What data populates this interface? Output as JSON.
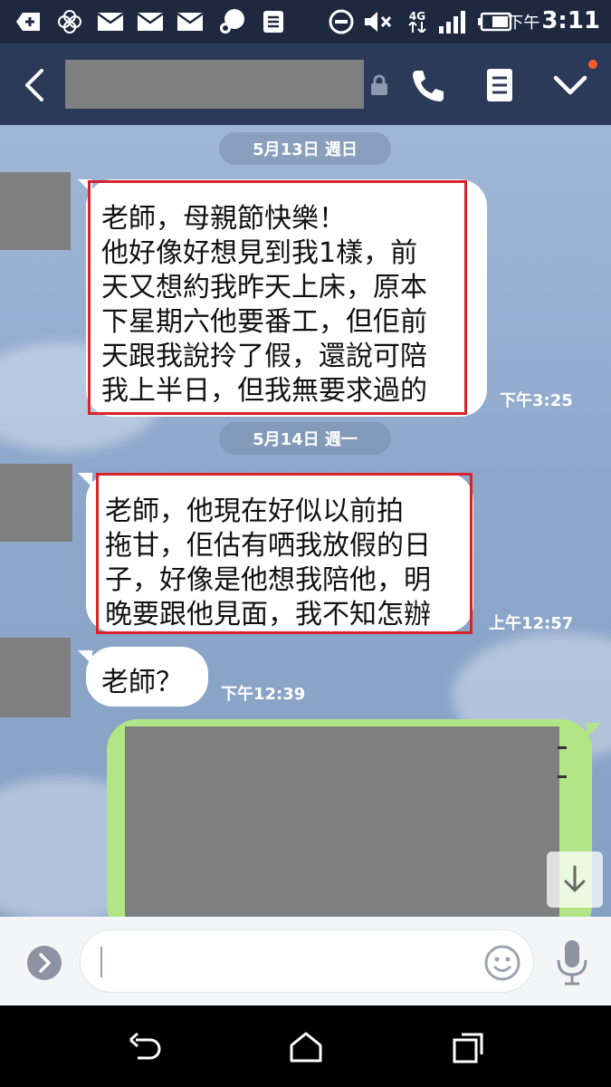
{
  "status_bar": {
    "ampm": "下午",
    "time": "3:11",
    "network": "4G",
    "icons": [
      "add-box-icon",
      "flower-app-icon",
      "mail-icon",
      "mail-icon",
      "mail-icon",
      "chat-bubble-icon",
      "document-icon",
      "do-not-disturb-icon",
      "mute-icon",
      "network-4g-icon",
      "signal-icon",
      "battery-icon"
    ]
  },
  "header": {
    "icons": [
      "back-arrow-icon",
      "lock-icon",
      "phone-icon",
      "notes-icon",
      "chevron-down-icon"
    ],
    "notification_color": "#ff5a2c"
  },
  "chat": {
    "dates": [
      "5月13日 週日",
      "5月14日 週一"
    ],
    "messages": [
      {
        "lines": [
          "老師，母親節快樂！",
          "他好像好想見到我1樣，前",
          "天又想約我昨天上床，原本",
          "下星期六他要番工，但佢前",
          "天跟我說拎了假，還說可陪",
          "我上半日，但我無要求過的"
        ],
        "time": "下午3:25"
      },
      {
        "lines": [
          " 老師，他現在好似以前拍",
          "拖甘，佢估有哂我放假的日",
          "子，好像是他想我陪他，明",
          "晚要跟他見面，我不知怎辦"
        ],
        "time": "上午12:57"
      },
      {
        "lines": [
          "老師？"
        ],
        "time": "下午12:39"
      }
    ],
    "highlight_color": "#d8232a",
    "sent_bubble_color": "#b2e585"
  },
  "input": {
    "icons": [
      "chevron-right-icon",
      "emoji-icon",
      "microphone-icon"
    ]
  },
  "nav": {
    "icons": [
      "back-icon",
      "home-icon",
      "recents-icon"
    ]
  }
}
